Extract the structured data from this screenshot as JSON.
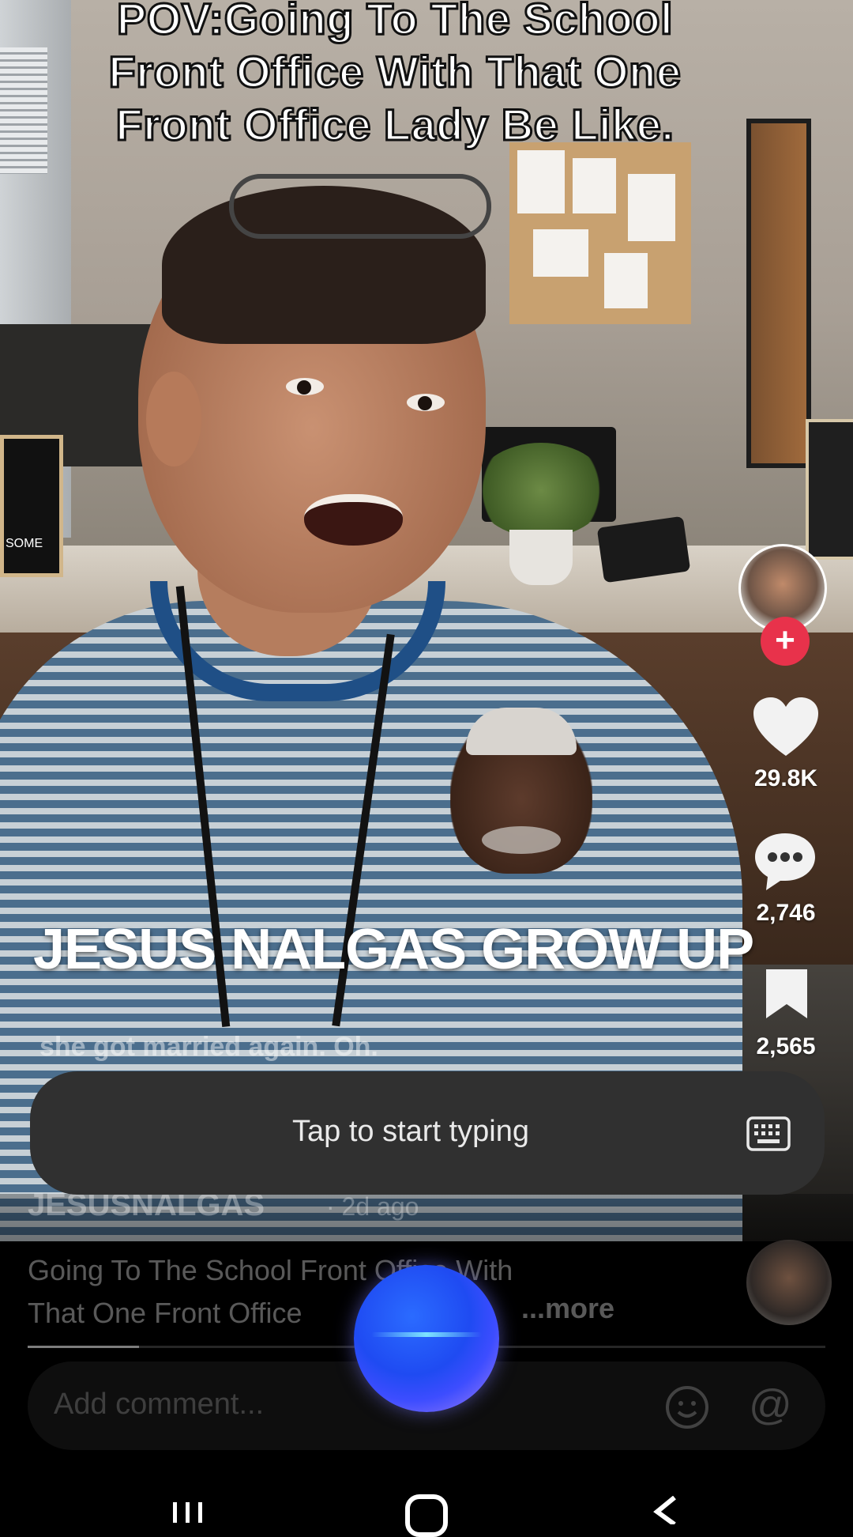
{
  "video": {
    "top_caption_lines": [
      "POV:Going To The School",
      "Front Office With That One",
      "Front Office Lady Be Like."
    ],
    "overlay_text": "JESUS NALGAS GROW UP",
    "subtitle_text": "she got married again. Oh.",
    "left_sign_text": "SOME"
  },
  "rail": {
    "follow_symbol": "+",
    "likes": "29.8K",
    "comments": "2,746",
    "saves": "2,565"
  },
  "post": {
    "username": "JESUSNALGAS",
    "time_ago": "· 2d ago",
    "description_line1": "Going To The School Front Office With",
    "description_line2": "That One Front Office",
    "more_label": "...more",
    "progress_fraction": 0.14
  },
  "comment": {
    "placeholder": "Add comment...",
    "at_symbol": "@"
  },
  "voice_input": {
    "prompt": "Tap to start typing"
  },
  "icons": {
    "like": "heart-icon",
    "comment": "comment-bubble-icon",
    "save": "bookmark-icon",
    "keyboard": "keyboard-icon",
    "emoji": "emoji-icon"
  },
  "colors": {
    "follow_accent": "#e8324b",
    "voice_orb": "#1f4bf2"
  }
}
